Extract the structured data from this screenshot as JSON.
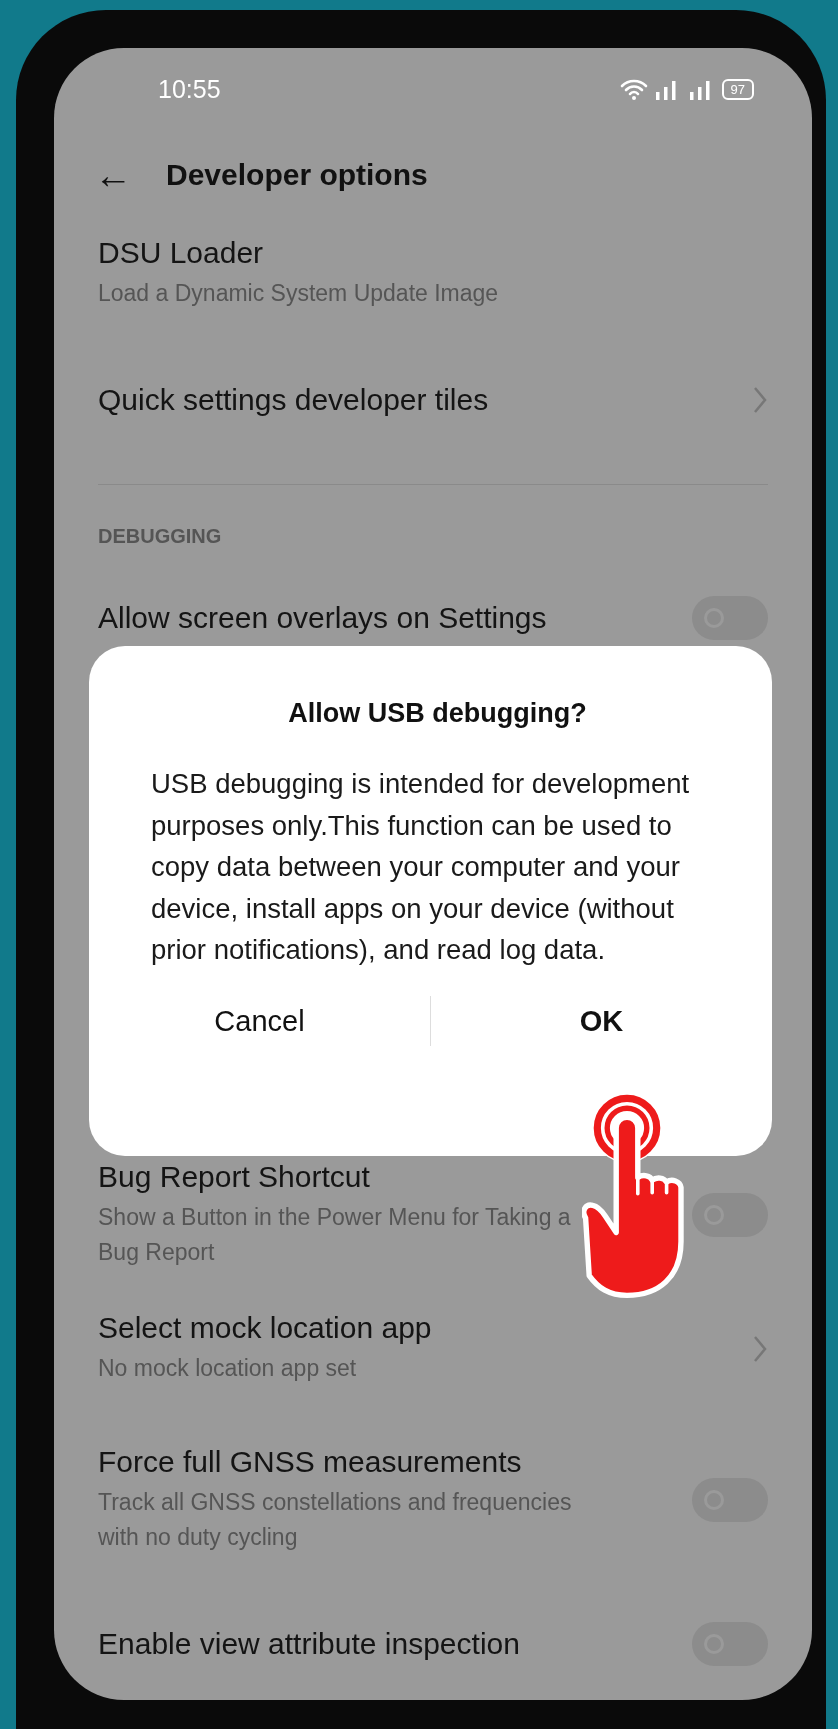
{
  "status_bar": {
    "time": "10:55",
    "battery": "97"
  },
  "header": {
    "back": "←",
    "title": "Developer options"
  },
  "items": [
    {
      "kind": "plain",
      "title": "DSU Loader",
      "subtitle": "Load a Dynamic System Update Image"
    },
    {
      "kind": "link",
      "title": "Quick settings developer tiles"
    },
    {
      "kind": "divider"
    },
    {
      "kind": "section",
      "title": "DEBUGGING"
    },
    {
      "kind": "toggle",
      "title": "Allow screen overlays on Settings",
      "on": false
    },
    {
      "kind": "gap"
    },
    {
      "kind": "toggle",
      "title": "Bug Report Shortcut",
      "subtitle": "Show a Button in the Power Menu for Taking a Bug Report",
      "on": false
    },
    {
      "kind": "link",
      "title": "Select mock location app",
      "subtitle": "No mock location app set"
    },
    {
      "kind": "toggle",
      "title": "Force full GNSS measurements",
      "subtitle": "Track all GNSS constellations and frequencies with no duty cycling",
      "on": false
    },
    {
      "kind": "toggle",
      "title": "Enable view attribute inspection",
      "on": false
    }
  ],
  "dialog": {
    "title": "Allow USB debugging?",
    "message": "USB debugging is intended for development purposes only.This function can be used to copy data between your computer and your device, install apps on your device (without prior notifications), and read log data.",
    "buttons": [
      {
        "label": "Cancel",
        "primary": false
      },
      {
        "label": "OK",
        "primary": true
      }
    ]
  }
}
